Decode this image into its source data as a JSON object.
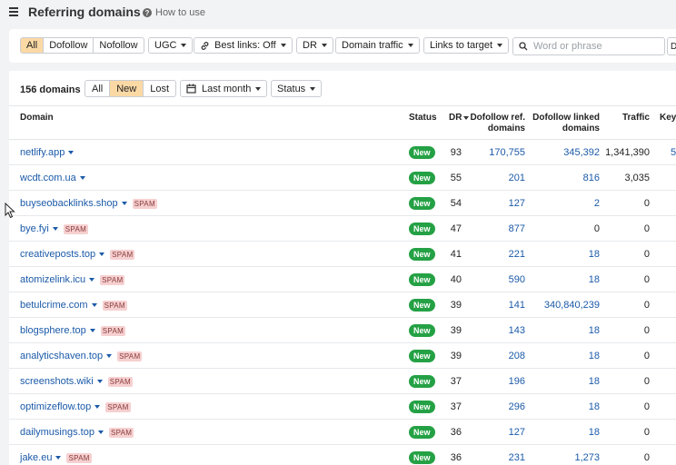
{
  "header": {
    "title": "Referring domains",
    "howto_label": "How to use"
  },
  "filters": {
    "type_tabs": [
      "All",
      "Dofollow",
      "Nofollow"
    ],
    "ugc_label": "UGC",
    "best_links_label": "Best links: Off",
    "dr_label": "DR",
    "domain_traffic_label": "Domain traffic",
    "links_to_target_label": "Links to target",
    "search_placeholder": "Word or phrase",
    "mode_btn": "D"
  },
  "toolbar": {
    "count_label": "156 domains",
    "status_tabs": [
      "All",
      "New",
      "Lost"
    ],
    "period_label": "Last month",
    "status_label": "Status"
  },
  "table": {
    "columns": {
      "domain": "Domain",
      "status": "Status",
      "dr": "DR",
      "ref_domains_1": "Dofollow ref.",
      "ref_domains_2": "domains",
      "linked_domains_1": "Dofollow linked",
      "linked_domains_2": "domains",
      "traffic": "Traffic",
      "keywords": "Key"
    },
    "rows": [
      {
        "domain": "netlify.app",
        "spam": "",
        "status": "New",
        "dr": "93",
        "ref": "170,755",
        "linked": "345,392",
        "traffic": "1,341,390",
        "kw": "5"
      },
      {
        "domain": "wcdt.com.ua",
        "spam": "",
        "status": "New",
        "dr": "55",
        "ref": "201",
        "linked": "816",
        "traffic": "3,035",
        "kw": ""
      },
      {
        "domain": "buyseobacklinks.shop",
        "spam": "SPAM",
        "status": "New",
        "dr": "54",
        "ref": "127",
        "linked": "2",
        "traffic": "0",
        "kw": ""
      },
      {
        "domain": "bye.fyi",
        "spam": "SPAM",
        "status": "New",
        "dr": "47",
        "ref": "877",
        "linked": "0",
        "traffic": "0",
        "kw": ""
      },
      {
        "domain": "creativeposts.top",
        "spam": "SPAM",
        "status": "New",
        "dr": "41",
        "ref": "221",
        "linked": "18",
        "traffic": "0",
        "kw": ""
      },
      {
        "domain": "atomizelink.icu",
        "spam": "SPAM",
        "status": "New",
        "dr": "40",
        "ref": "590",
        "linked": "18",
        "traffic": "0",
        "kw": ""
      },
      {
        "domain": "betulcrime.com",
        "spam": "SPAM",
        "status": "New",
        "dr": "39",
        "ref": "141",
        "linked": "340,840,239",
        "traffic": "0",
        "kw": ""
      },
      {
        "domain": "blogsphere.top",
        "spam": "SPAM",
        "status": "New",
        "dr": "39",
        "ref": "143",
        "linked": "18",
        "traffic": "0",
        "kw": ""
      },
      {
        "domain": "analyticshaven.top",
        "spam": "SPAM",
        "status": "New",
        "dr": "39",
        "ref": "208",
        "linked": "18",
        "traffic": "0",
        "kw": ""
      },
      {
        "domain": "screenshots.wiki",
        "spam": "SPAM",
        "status": "New",
        "dr": "37",
        "ref": "196",
        "linked": "18",
        "traffic": "0",
        "kw": ""
      },
      {
        "domain": "optimizeflow.top",
        "spam": "SPAM",
        "status": "New",
        "dr": "37",
        "ref": "296",
        "linked": "18",
        "traffic": "0",
        "kw": ""
      },
      {
        "domain": "dailymusings.top",
        "spam": "SPAM",
        "status": "New",
        "dr": "36",
        "ref": "127",
        "linked": "18",
        "traffic": "0",
        "kw": ""
      },
      {
        "domain": "jake.eu",
        "spam": "SPAM",
        "status": "New",
        "dr": "36",
        "ref": "231",
        "linked": "1,273",
        "traffic": "0",
        "kw": ""
      }
    ]
  },
  "colors": {
    "link": "#1b5aa8",
    "new_badge": "#25a145",
    "active_tab": "#fbd9a5",
    "spam_bg": "#f6d0d0"
  }
}
